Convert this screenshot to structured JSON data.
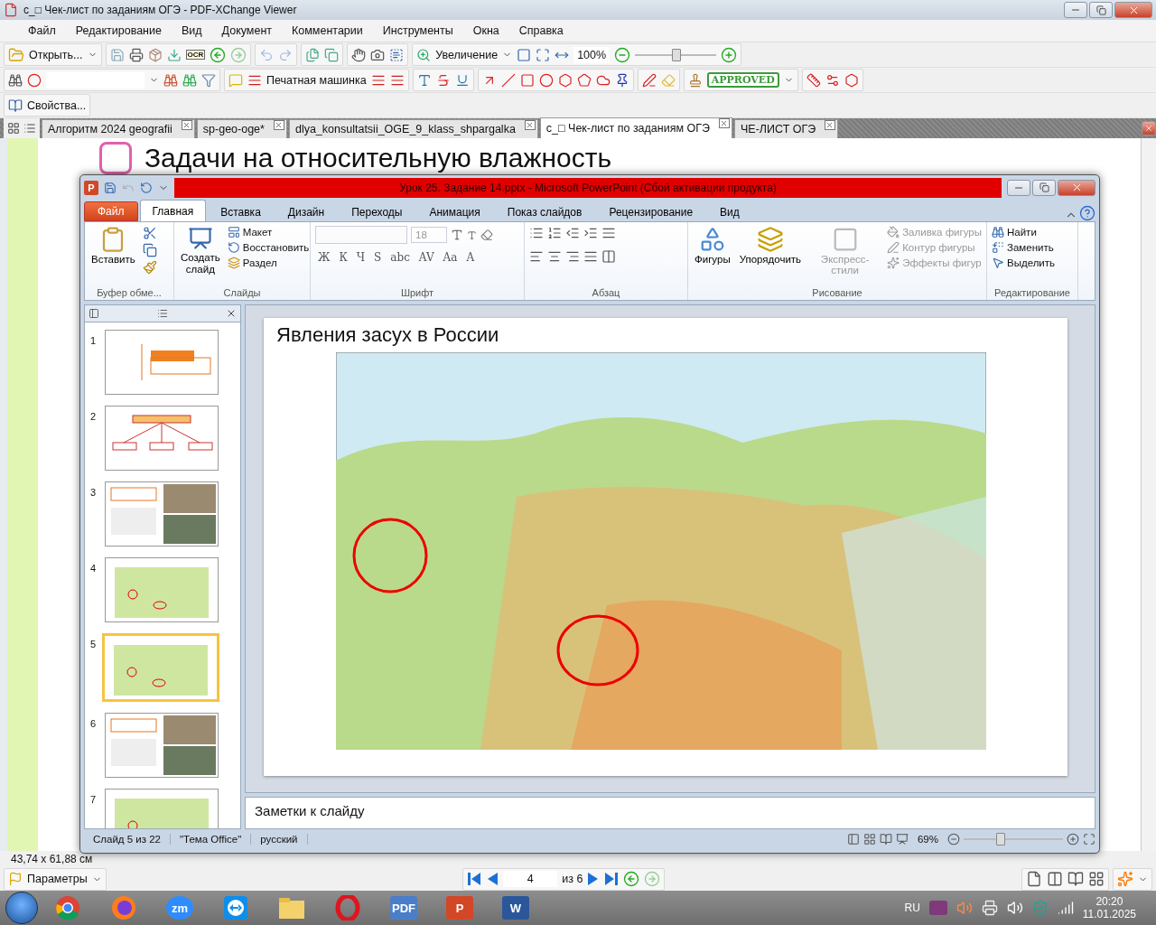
{
  "pdf_window": {
    "title": "с_□ Чек-лист по заданиям ОГЭ - PDF-XChange Viewer",
    "menu": [
      "Файл",
      "Редактирование",
      "Вид",
      "Документ",
      "Комментарии",
      "Инструменты",
      "Окна",
      "Справка"
    ],
    "toolbar": {
      "open_label": "Открыть...",
      "ocr_label": "OCR",
      "zoom_label": "Увеличение",
      "zoom_value": "100%",
      "level": 0.5,
      "typewriter_label": "Печатная машинка",
      "stamp_label": "APPROVED",
      "properties_label": "Свойства..."
    },
    "tabs": [
      {
        "label": "Алгоритм 2024 geografii",
        "selected": false
      },
      {
        "label": "sp-geo-oge*",
        "selected": false
      },
      {
        "label": "dlya_konsultatsii_OGE_9_klass_shpargalka",
        "selected": false
      },
      {
        "label": "с_□ Чек-лист по заданиям ОГЭ",
        "selected": true
      },
      {
        "label": "ЧЕ-ЛИСТ ОГЭ",
        "selected": false
      }
    ],
    "document_heading": "Задачи на относительную влажность",
    "page_size": "43,74 x 61,88 см",
    "nav": {
      "options_label": "Параметры",
      "page": "4",
      "page_total": "из 6"
    }
  },
  "ppt_window": {
    "app_letter": "P",
    "title": "Урок 25. Задание 14.pptx  -  Microsoft PowerPoint (Сбой активации продукта)",
    "file_tab": "Файл",
    "tabs": [
      {
        "label": "Главная",
        "selected": true
      },
      {
        "label": "Вставка",
        "selected": false
      },
      {
        "label": "Дизайн",
        "selected": false
      },
      {
        "label": "Переходы",
        "selected": false
      },
      {
        "label": "Анимация",
        "selected": false
      },
      {
        "label": "Показ слайдов",
        "selected": false
      },
      {
        "label": "Рецензирование",
        "selected": false
      },
      {
        "label": "Вид",
        "selected": false
      }
    ],
    "ribbon": {
      "paste": "Вставить",
      "clipboard_group": "Буфер обме...",
      "new_slide": [
        "Создать",
        "слайд"
      ],
      "layout": "Макет",
      "reset": "Восстановить",
      "section": "Раздел",
      "slides_group": "Слайды",
      "font_size": "18",
      "font_buttons": [
        "Ж",
        "К",
        "Ч",
        "S",
        "abc",
        "AV",
        "Aa",
        "A"
      ],
      "font_group": "Шрифт",
      "paragraph_group": "Абзац",
      "shapes": "Фигуры",
      "arrange": "Упорядочить",
      "quick_styles": {
        "label": "Экспресс-стили",
        "disabled": true
      },
      "shape_format": [
        {
          "label": "Заливка фигуры",
          "disabled": true
        },
        {
          "label": "Контур фигуры",
          "disabled": true
        },
        {
          "label": "Эффекты фигур",
          "disabled": true
        }
      ],
      "drawing_group": "Рисование",
      "find": "Найти",
      "replace": "Заменить",
      "select": "Выделить",
      "editing_group": "Редактирование"
    },
    "slides": [
      {
        "number": "1",
        "selected": false,
        "kind": "plan"
      },
      {
        "number": "2",
        "selected": false,
        "kind": "tree"
      },
      {
        "number": "3",
        "selected": false,
        "kind": "photos"
      },
      {
        "number": "4",
        "selected": false,
        "kind": "map"
      },
      {
        "number": "5",
        "selected": true,
        "kind": "map"
      },
      {
        "number": "6",
        "selected": false,
        "kind": "photos"
      },
      {
        "number": "7",
        "selected": false,
        "kind": "map"
      }
    ],
    "slide_title": "Явления засух в России",
    "notes_placeholder": "Заметки к слайду",
    "status": {
      "slide": "Слайд 5 из 22",
      "theme": "\"Тема Office\"",
      "language": "русский",
      "zoom": "69%",
      "level": 0.35
    }
  },
  "taskbar": {
    "zoom_logo": "zm",
    "pdf_logo": "PDF",
    "ppt_logo": "P",
    "word_logo": "W",
    "language": "RU",
    "time": "20:20",
    "date": "11.01.2025"
  }
}
